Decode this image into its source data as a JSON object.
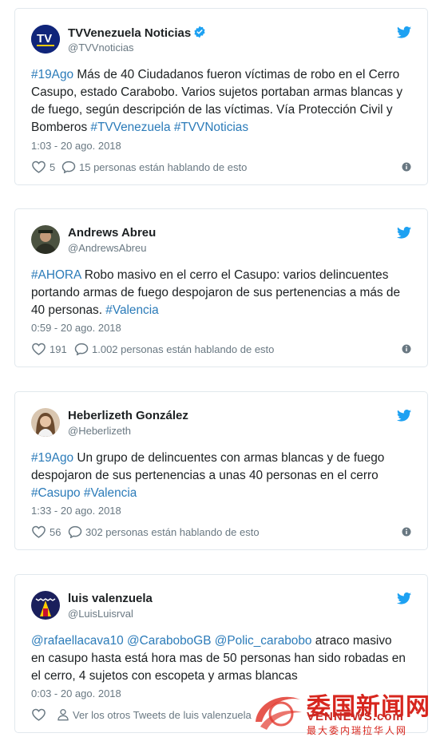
{
  "tweets": [
    {
      "name": "TVVenezuela Noticias",
      "handle": "@TVVnoticias",
      "verified": true,
      "text_parts": [
        {
          "t": "#19Ago",
          "tag": true
        },
        {
          "t": " Más de 40 Ciudadanos fueron víctimas de robo en el Cerro Casupo, estado Carabobo. Varios sujetos portaban armas blancas y de fuego, según descripción de las víctimas. Vía Protección Civil y Bomberos ",
          "tag": false
        },
        {
          "t": "#TVVenezuela",
          "tag": true
        },
        {
          "t": " ",
          "tag": false
        },
        {
          "t": "#TVVNoticias",
          "tag": true
        }
      ],
      "time": "1:03 - 20 ago. 2018",
      "likes": "5",
      "talking": "15 personas están hablando de esto"
    },
    {
      "name": "Andrews Abreu",
      "handle": "@AndrewsAbreu",
      "verified": false,
      "text_parts": [
        {
          "t": "#AHORA",
          "tag": true
        },
        {
          "t": " Robo masivo en el cerro el Casupo: varios delincuentes portando armas de fuego despojaron de sus pertenencias a más de 40 personas. ",
          "tag": false
        },
        {
          "t": "#Valencia",
          "tag": true
        }
      ],
      "time": "0:59 - 20 ago. 2018",
      "likes": "191",
      "talking": "1.002 personas están hablando de esto"
    },
    {
      "name": "Heberlizeth González",
      "handle": "@Heberlizeth",
      "verified": false,
      "text_parts": [
        {
          "t": "#19Ago",
          "tag": true
        },
        {
          "t": " Un grupo de delincuentes con armas blancas y de fuego despojaron de sus pertenencias a unas 40 personas en el cerro ",
          "tag": false
        },
        {
          "t": "#Casupo",
          "tag": true
        },
        {
          "t": " ",
          "tag": false
        },
        {
          "t": "#Valencia",
          "tag": true
        }
      ],
      "time": "1:33 - 20 ago. 2018",
      "likes": "56",
      "talking": "302 personas están hablando de esto"
    },
    {
      "name": "luis valenzuela",
      "handle": "@LuisLuisrval",
      "verified": false,
      "text_parts": [
        {
          "t": "@rafaellacava10",
          "tag": true
        },
        {
          "t": " ",
          "tag": false
        },
        {
          "t": "@CaraboboGB",
          "tag": true
        },
        {
          "t": " ",
          "tag": false
        },
        {
          "t": "@Polic_carabobo",
          "tag": true
        },
        {
          "t": " atraco masivo en casupo hasta está hora mas de 50 personas han sido robadas en el cerro, 4 sujetos con escopeta y armas blancas",
          "tag": false
        }
      ],
      "time": "0:03 - 20 ago. 2018",
      "likes": "",
      "talking": "Ver los otros Tweets de luis valenzuela"
    }
  ],
  "watermark": {
    "cn": "委国新闻网",
    "en": "VENNEWS.com",
    "sub": "最大委内瑞拉华人网"
  },
  "colors": {
    "link": "#2b7bb9",
    "bird": "#1da1f2",
    "meta": "#697882",
    "border": "#e1e8ed"
  }
}
